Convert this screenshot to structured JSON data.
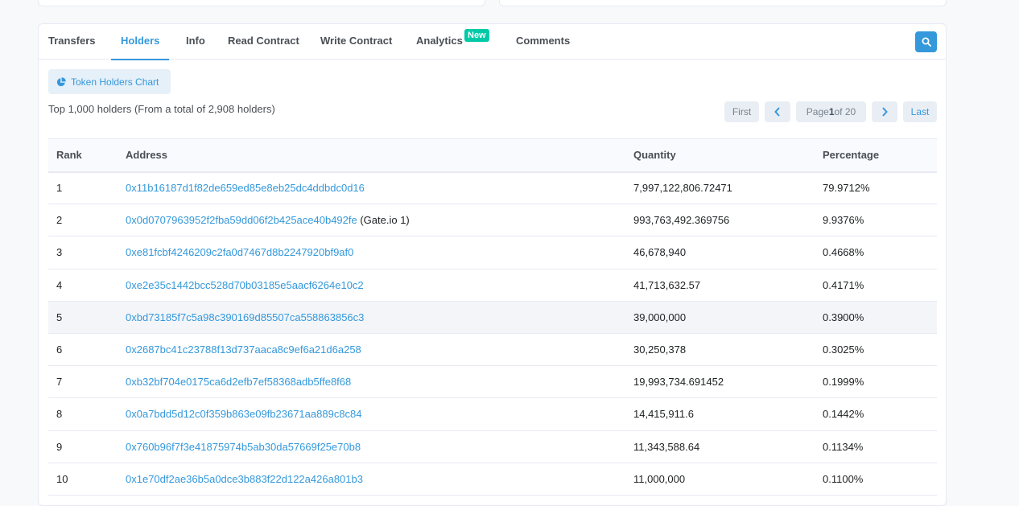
{
  "tabs": [
    {
      "label": "Transfers"
    },
    {
      "label": "Holders"
    },
    {
      "label": "Info"
    },
    {
      "label": "Read Contract"
    },
    {
      "label": "Write Contract"
    },
    {
      "label": "Analytics"
    },
    {
      "label": "Comments"
    }
  ],
  "active_tab": "Holders",
  "analytics_badge": "New",
  "chart_button_label": "Token Holders Chart",
  "summary": "Top 1,000 holders (From a total of 2,908 holders)",
  "pagination": {
    "first": "First",
    "page_prefix": "Page ",
    "page_current": "1",
    "page_suffix": " of 20",
    "last": "Last"
  },
  "table": {
    "headers": [
      "Rank",
      "Address",
      "Quantity",
      "Percentage"
    ],
    "rows": [
      {
        "rank": "1",
        "address": "0x11b16187d1f82de659ed85e8eb25dc4ddbdc0d16",
        "tag": "",
        "quantity": "7,997,122,806.72471",
        "percentage": "79.9712%"
      },
      {
        "rank": "2",
        "address": "0x0d0707963952f2fba59dd06f2b425ace40b492fe",
        "tag": " (Gate.io 1)",
        "quantity": "993,763,492.369756",
        "percentage": "9.9376%"
      },
      {
        "rank": "3",
        "address": "0xe81fcbf4246209c2fa0d7467d8b2247920bf9af0",
        "tag": "",
        "quantity": "46,678,940",
        "percentage": "0.4668%"
      },
      {
        "rank": "4",
        "address": "0xe2e35c1442bcc528d70b03185e5aacf6264e10c2",
        "tag": "",
        "quantity": "41,713,632.57",
        "percentage": "0.4171%"
      },
      {
        "rank": "5",
        "address": "0xbd73185f7c5a98c390169d85507ca558863856c3",
        "tag": "",
        "quantity": "39,000,000",
        "percentage": "0.3900%"
      },
      {
        "rank": "6",
        "address": "0x2687bc41c23788f13d737aaca8c9ef6a21d6a258",
        "tag": "",
        "quantity": "30,250,378",
        "percentage": "0.3025%"
      },
      {
        "rank": "7",
        "address": "0xb32bf704e0175ca6d2efb7ef58368adb5ffe8f68",
        "tag": "",
        "quantity": "19,993,734.691452",
        "percentage": "0.1999%"
      },
      {
        "rank": "8",
        "address": "0x0a7bdd5d12c0f359b863e09fb23671aa889c8c84",
        "tag": "",
        "quantity": "14,415,911.6",
        "percentage": "0.1442%"
      },
      {
        "rank": "9",
        "address": "0x760b96f7f3e41875974b5ab30da57669f25e70b8",
        "tag": "",
        "quantity": "11,343,588.64",
        "percentage": "0.1134%"
      },
      {
        "rank": "10",
        "address": "0x1e70df2ae36b5a0dce3b883f22d122a426a801b3",
        "tag": "",
        "quantity": "11,000,000",
        "percentage": "0.1100%"
      }
    ]
  },
  "icons": {
    "search": "search-icon",
    "pie": "pie-chart-icon",
    "prev": "chevron-left-icon",
    "next": "chevron-right-icon"
  },
  "colors": {
    "accent": "#3498db",
    "badge": "#00c9a7"
  }
}
